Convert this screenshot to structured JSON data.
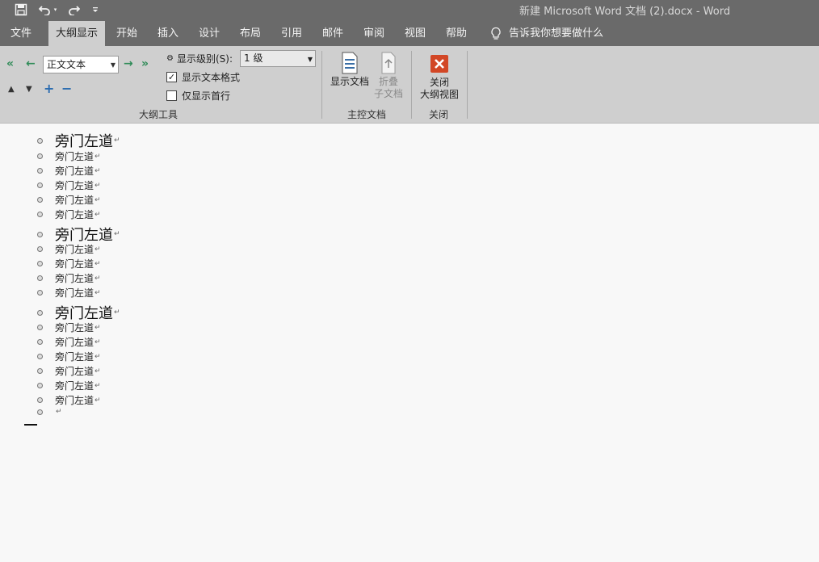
{
  "titlebar": {
    "title": "新建 Microsoft Word 文档 (2).docx  -  Word"
  },
  "tabs": [
    {
      "label": "文件",
      "active": false
    },
    {
      "label": "大纲显示",
      "active": true
    },
    {
      "label": "开始",
      "active": false
    },
    {
      "label": "插入",
      "active": false
    },
    {
      "label": "设计",
      "active": false
    },
    {
      "label": "布局",
      "active": false
    },
    {
      "label": "引用",
      "active": false
    },
    {
      "label": "邮件",
      "active": false
    },
    {
      "label": "审阅",
      "active": false
    },
    {
      "label": "视图",
      "active": false
    },
    {
      "label": "帮助",
      "active": false
    }
  ],
  "tell_me": "告诉我你想要做什么",
  "ribbon": {
    "style_value": "正文文本",
    "show_level_label": "显示级别(S):",
    "show_level_value": "1 级",
    "show_text_format": "显示文本格式",
    "show_first_line_only": "仅显示首行",
    "outline_tools_label": "大纲工具",
    "show_document": "显示文档",
    "collapse_sub_1": "折叠",
    "collapse_sub_2": "子文档",
    "master_doc_label": "主控文档",
    "close_1": "关闭",
    "close_2": "大纲视图",
    "close_group_label": "关闭"
  },
  "outline": [
    {
      "text": "旁门左道",
      "level": 1
    },
    {
      "text": "旁门左道",
      "level": 0
    },
    {
      "text": "旁门左道",
      "level": 0
    },
    {
      "text": "旁门左道",
      "level": 0
    },
    {
      "text": "旁门左道",
      "level": 0
    },
    {
      "text": "旁门左道",
      "level": 0
    },
    {
      "text": "旁门左道",
      "level": 1
    },
    {
      "text": "旁门左道",
      "level": 0
    },
    {
      "text": "旁门左道",
      "level": 0
    },
    {
      "text": "旁门左道",
      "level": 0
    },
    {
      "text": "旁门左道",
      "level": 0
    },
    {
      "text": "旁门左道",
      "level": 1
    },
    {
      "text": "旁门左道",
      "level": 0
    },
    {
      "text": "旁门左道",
      "level": 0
    },
    {
      "text": "旁门左道",
      "level": 0
    },
    {
      "text": "旁门左道",
      "level": 0
    },
    {
      "text": "旁门左道",
      "level": 0
    },
    {
      "text": "旁门左道",
      "level": 0
    },
    {
      "text": "",
      "level": 0
    }
  ],
  "paragraph_mark": "↵"
}
